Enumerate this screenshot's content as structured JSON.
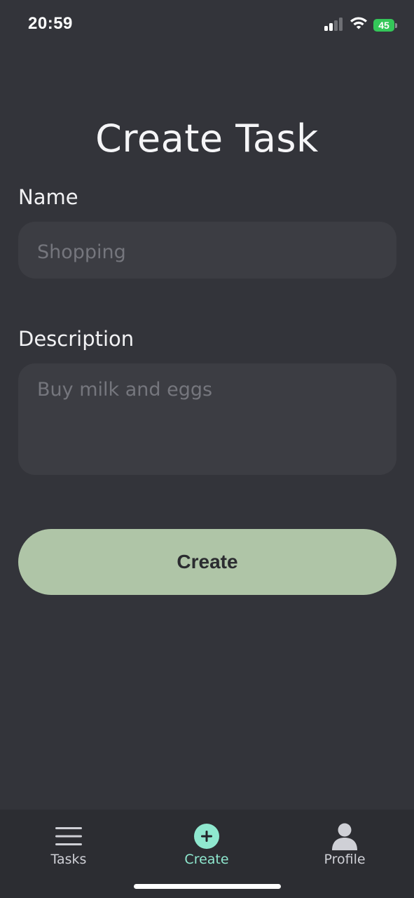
{
  "status_bar": {
    "time": "20:59",
    "battery_level": "45",
    "battery_color": "#34c759"
  },
  "page": {
    "title": "Create Task"
  },
  "form": {
    "name_label": "Name",
    "name_placeholder": "Shopping",
    "name_value": "",
    "description_label": "Description",
    "description_placeholder": "Buy milk and eggs",
    "description_value": "",
    "submit_label": "Create"
  },
  "bottom_nav": {
    "items": [
      {
        "label": "Tasks",
        "icon": "menu-icon",
        "active": false
      },
      {
        "label": "Create",
        "icon": "plus-circle-icon",
        "active": true
      },
      {
        "label": "Profile",
        "icon": "person-icon",
        "active": false
      }
    ]
  },
  "colors": {
    "background": "#33343a",
    "input_background": "#3c3d43",
    "button_background": "#afc5a7",
    "active_nav": "#8fe8cf",
    "nav_background": "#2c2d32"
  }
}
